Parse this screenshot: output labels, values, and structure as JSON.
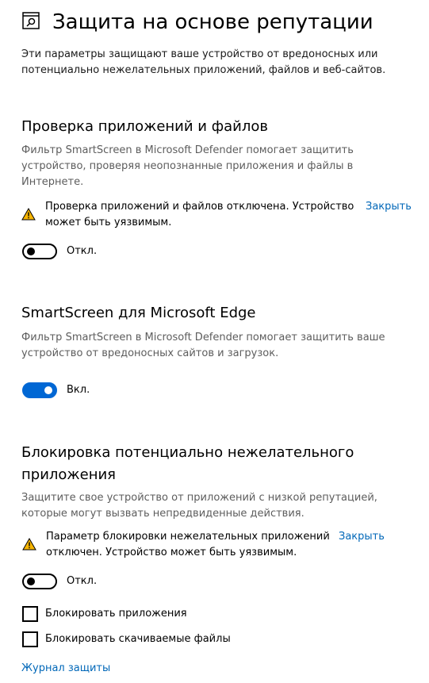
{
  "header": {
    "icon": "browser-shield-icon",
    "title": "Защита на основе репутации",
    "description": "Эти параметры защищают ваше устройство от вредоносных или потенциально нежелательных приложений, файлов и веб-сайтов."
  },
  "app_check": {
    "title": "Проверка приложений и файлов",
    "description": "Фильтр SmartScreen в Microsoft Defender помогает защитить устройство, проверяя неопознанные приложения и файлы в Интернете.",
    "warning_icon": "warning-icon",
    "warning_text": "Проверка приложений и файлов отключена. Устройство может быть уязвимым.",
    "dismiss_label": "Закрыть",
    "toggle_state": "off",
    "toggle_label": "Откл."
  },
  "edge": {
    "title": "SmartScreen для Microsoft Edge",
    "description": "Фильтр SmartScreen в Microsoft Defender помогает защитить ваше устройство от вредоносных сайтов и загрузок.",
    "toggle_state": "on",
    "toggle_label": "Вкл."
  },
  "pua": {
    "title_line1": "Блокировка потенциально нежелательного",
    "title_line2": "приложения",
    "description": "Защитите свое устройство от приложений с низкой репутацией, которые могут вызвать непредвиденные действия.",
    "warning_icon": "warning-icon",
    "warning_text": "Параметр блокировки нежелательных приложений отключен. Устройство может быть уязвимым.",
    "dismiss_label": "Закрыть",
    "toggle_state": "off",
    "toggle_label": "Откл.",
    "checkboxes": [
      {
        "label": "Блокировать приложения",
        "checked": false
      },
      {
        "label": "Блокировать скачиваемые файлы",
        "checked": false
      }
    ]
  },
  "footer": {
    "history_link": "Журнал защиты"
  },
  "colors": {
    "accent": "#0067d4",
    "link": "#0067b8",
    "warning": "#f7b500",
    "secondary_text": "#5d5d5d"
  }
}
